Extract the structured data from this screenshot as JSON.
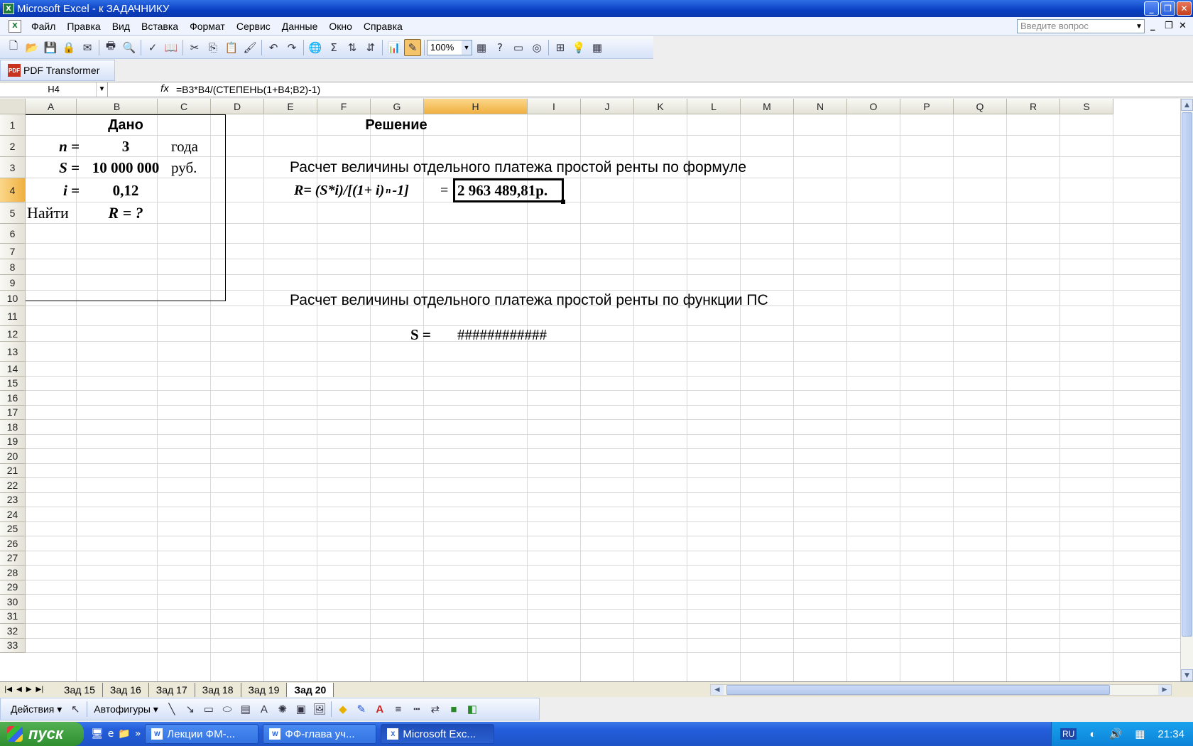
{
  "window": {
    "title": "Microsoft Excel - к ЗАДАЧНИКУ"
  },
  "menu": [
    "Файл",
    "Правка",
    "Вид",
    "Вставка",
    "Формат",
    "Сервис",
    "Данные",
    "Окно",
    "Справка"
  ],
  "help": {
    "placeholder": "Введите вопрос"
  },
  "toolbar": {
    "zoom": "100%"
  },
  "toolbar2": {
    "label": "PDF Transformer",
    "icon": "PDF"
  },
  "formula_bar": {
    "name_box": "H4",
    "fx": "fx",
    "formula": "=B3*B4/(СТЕПЕНЬ(1+B4;B2)-1)"
  },
  "columns": [
    "A",
    "B",
    "C",
    "D",
    "E",
    "F",
    "G",
    "H",
    "I",
    "J",
    "K",
    "L",
    "M",
    "N",
    "O",
    "P",
    "Q",
    "R",
    "S"
  ],
  "selected_column": "H",
  "rows": [
    "1",
    "2",
    "3",
    "4",
    "5",
    "6",
    "7",
    "8",
    "9",
    "10",
    "11",
    "12",
    "13",
    "14",
    "15",
    "16",
    "17",
    "18",
    "19",
    "20",
    "21",
    "22",
    "23",
    "24",
    "25",
    "26",
    "27",
    "28",
    "29",
    "30",
    "31",
    "32",
    "33"
  ],
  "selected_row": "4",
  "cells": {
    "b1": "Дано",
    "f1": "Решение",
    "a2": "n =",
    "b2": "3",
    "c2": "года",
    "a3": "S =",
    "b3": "10 000 000",
    "c3": "руб.",
    "a4": "i =",
    "b4": "0,12",
    "a5": "Найти",
    "b5": "R = ?",
    "e3": "Расчет величины отдельного платежа простой ренты по формуле",
    "e4_formula": "R= (S*i)/[(1+ i)",
    "e4_sup": "n",
    "e4_tail": "-1]",
    "g4_eq": "=",
    "h4": "2 963 489,81р.",
    "e11": "Расчет величины отдельного платежа простой ренты по функции ПС",
    "g13": "S  =",
    "h13": "############"
  },
  "sheets": [
    "Зад 15",
    "Зад 16",
    "Зад 17",
    "Зад 18",
    "Зад 19",
    "Зад 20"
  ],
  "active_sheet": "Зад 20",
  "drawing": {
    "actions": "Действия",
    "autoshapes": "Автофигуры"
  },
  "taskbar": {
    "start": "пуск",
    "tasks": [
      "Лекции ФМ-...",
      "ФФ-глава уч...",
      "Microsoft Exc..."
    ],
    "lang": "RU",
    "clock": "21:34"
  }
}
